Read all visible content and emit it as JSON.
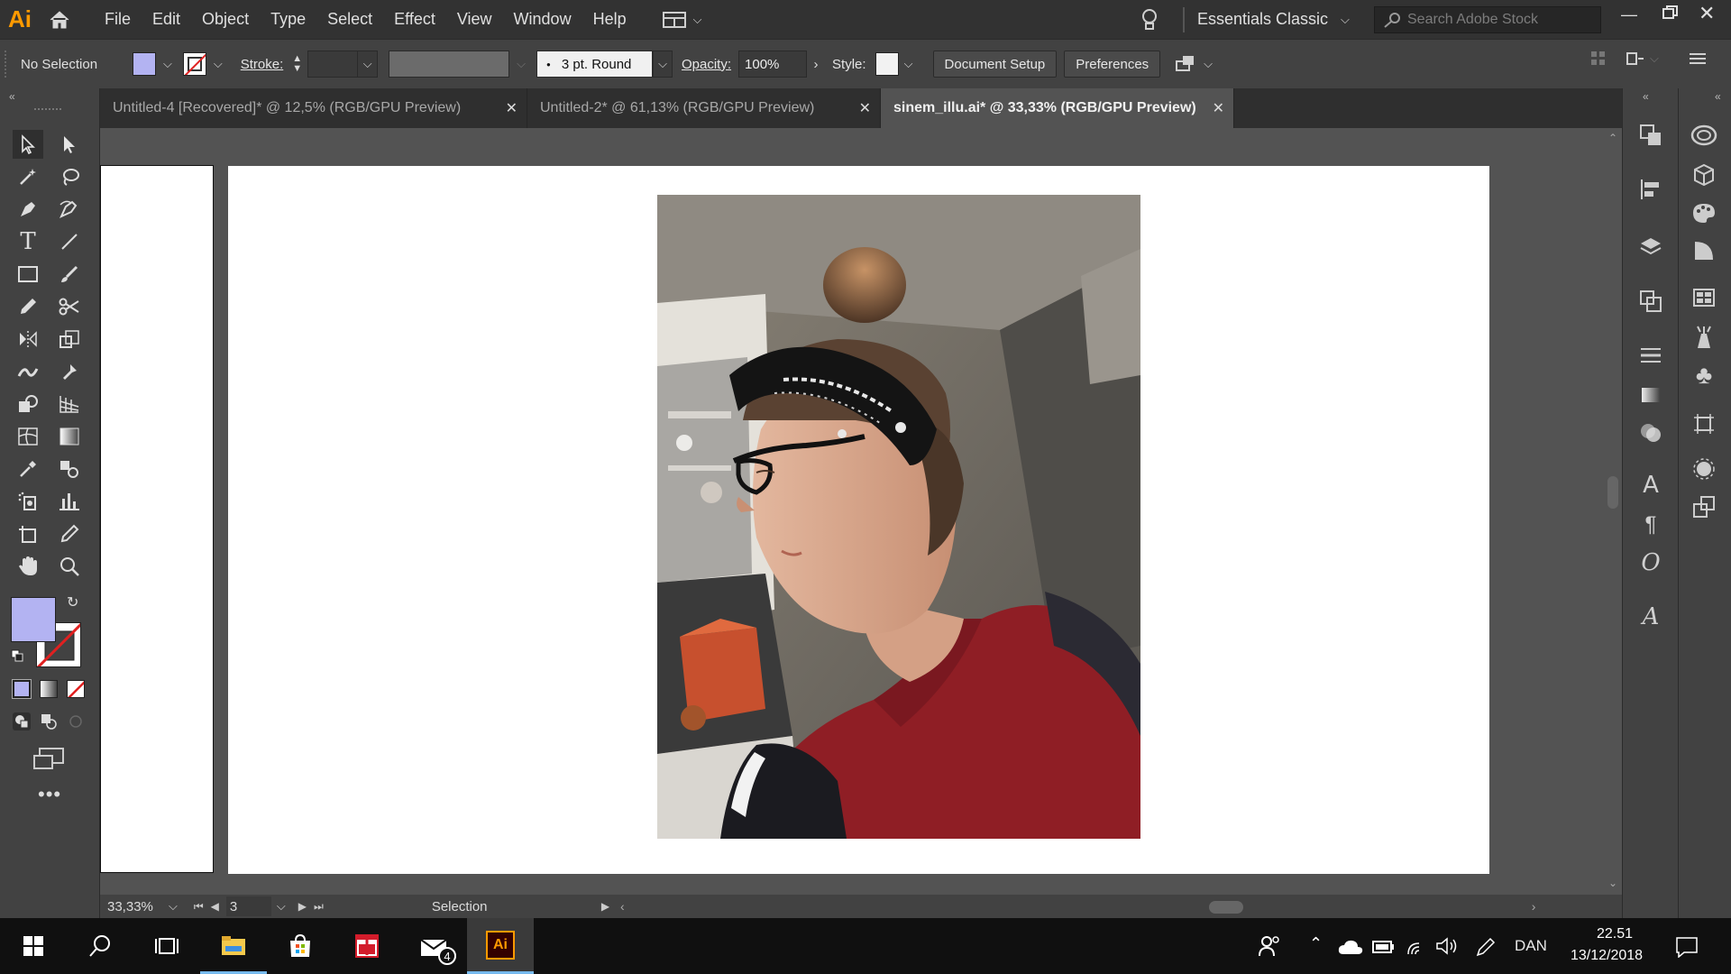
{
  "menubar": {
    "logo": "Ai",
    "items": [
      "File",
      "Edit",
      "Object",
      "Type",
      "Select",
      "Effect",
      "View",
      "Window",
      "Help"
    ],
    "workspace": "Essentials Classic",
    "search_placeholder": "Search Adobe Stock"
  },
  "controlbar": {
    "selection": "No Selection",
    "stroke_label": "Stroke:",
    "brush_label": "3 pt. Round",
    "opacity_label": "Opacity:",
    "opacity_value": "100%",
    "style_label": "Style:",
    "document_setup": "Document Setup",
    "preferences": "Preferences"
  },
  "tabs": [
    {
      "label": "Untitled-4 [Recovered]* @ 12,5% (RGB/GPU Preview)"
    },
    {
      "label": "Untitled-2* @ 61,13% (RGB/GPU Preview)"
    },
    {
      "label": "sinem_illu.ai* @ 33,33% (RGB/GPU Preview)"
    }
  ],
  "status": {
    "zoom": "33,33%",
    "artboard": "3",
    "tool": "Selection"
  },
  "taskbar": {
    "mail_badge": "4",
    "language": "DAN",
    "time": "22.51",
    "date": "13/12/2018"
  },
  "colors": {
    "fill_swatch": "#b3b3f2",
    "app_orange": "#ff9a00",
    "shirt_red": "#8f1e25"
  }
}
